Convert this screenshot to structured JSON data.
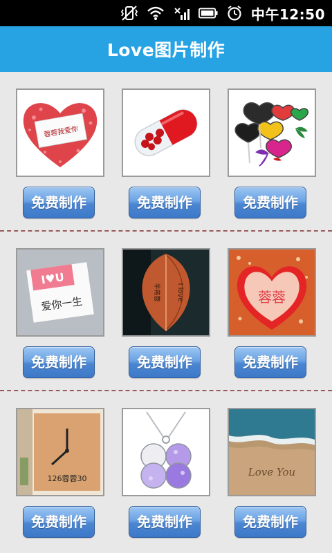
{
  "status_bar": {
    "icons": [
      "vibrate-off-icon",
      "wifi-icon",
      "signal-off-icon",
      "battery-icon",
      "alarm-clock-icon"
    ],
    "time": "中午12:50"
  },
  "header": {
    "title": "Love图片制作"
  },
  "grid": {
    "items": [
      {
        "image": "heart-rose-petals-card",
        "button_label": "免费制作"
      },
      {
        "image": "red-pill-capsule-hearts",
        "button_label": "免费制作"
      },
      {
        "image": "heart-lollipops",
        "button_label": "免费制作"
      },
      {
        "image": "i-love-u-card",
        "button_label": "免费制作"
      },
      {
        "image": "leaf-i-love",
        "button_label": "免费制作"
      },
      {
        "image": "heart-cookie",
        "button_label": "免费制作"
      },
      {
        "image": "wooden-clock",
        "button_label": "免费制作"
      },
      {
        "image": "clover-pendant-necklace",
        "button_label": "免费制作"
      },
      {
        "image": "love-you-beach-sand",
        "button_label": "免费制作"
      }
    ]
  },
  "image_text": {
    "card1": "蓉蓉我爱你",
    "card4_top": "I♥U",
    "card4_bottom": "爱你一生",
    "card5_left": "半蒋蓉",
    "card5_right": "I love",
    "card6": "蓉蓉",
    "card7": "126蓉蓉30",
    "card9": "Love You"
  },
  "colors": {
    "status_bar_bg": "#000000",
    "title_bar_bg": "#27a3e3",
    "content_bg": "#e8e8e8",
    "button_blue": "#4b86d3",
    "divider": "#9a5a5a"
  }
}
